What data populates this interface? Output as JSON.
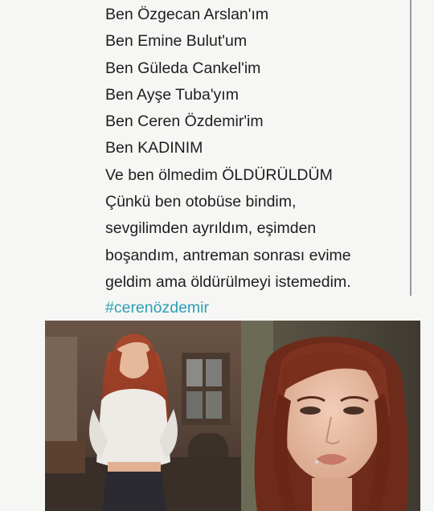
{
  "poem": {
    "lines": [
      "Ben Özgecan Arslan'ım",
      "Ben Emine Bulut'um",
      "Ben Güleda Cankel'im",
      "Ben Ayşe Tuba'yım",
      "Ben Ceren Özdemir'im",
      "Ben KADINIM",
      "Ve ben ölmedim ÖLDÜRÜLDÜM",
      "Çünkü ben otobüse bindim,",
      "sevgilimden ayrıldım, eşimden",
      "boşandım, antreman sonrası evime",
      "geldim ama öldürülmeyi istemedim."
    ],
    "hashtag": "#cerenözdemir"
  },
  "colors": {
    "text": "#1e1e1e",
    "hashtag": "#2c9fb4",
    "background": "#f6f6f4"
  },
  "photos": {
    "left": {
      "description_icon": "photo-standing-woman"
    },
    "right": {
      "description_icon": "photo-portrait-woman"
    }
  }
}
